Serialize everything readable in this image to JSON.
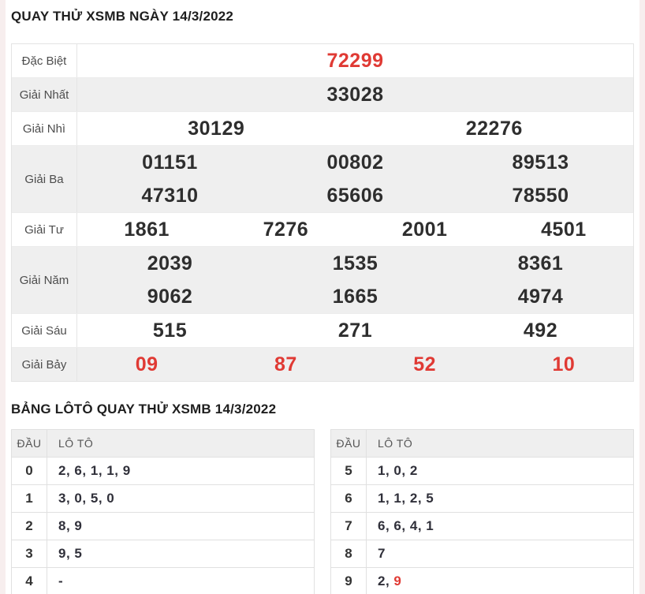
{
  "colors": {
    "accent_red": "#e03a34",
    "stripe_bg": "#efefef",
    "border": "#e4e4e4"
  },
  "page": {
    "title": "QUAY THỬ XSMB NGÀY 14/3/2022",
    "loto_title": "BẢNG LÔTÔ QUAY THỬ XSMB 14/3/2022"
  },
  "results": {
    "rows": [
      {
        "label": "Đặc Biệt",
        "highlight": true,
        "lines": [
          [
            "72299"
          ]
        ]
      },
      {
        "label": "Giải Nhất",
        "highlight": false,
        "lines": [
          [
            "33028"
          ]
        ]
      },
      {
        "label": "Giải Nhì",
        "highlight": false,
        "lines": [
          [
            "30129",
            "22276"
          ]
        ]
      },
      {
        "label": "Giải Ba",
        "highlight": false,
        "lines": [
          [
            "01151",
            "00802",
            "89513"
          ],
          [
            "47310",
            "65606",
            "78550"
          ]
        ]
      },
      {
        "label": "Giải Tư",
        "highlight": false,
        "lines": [
          [
            "1861",
            "7276",
            "2001",
            "4501"
          ]
        ]
      },
      {
        "label": "Giải Năm",
        "highlight": false,
        "lines": [
          [
            "2039",
            "1535",
            "8361"
          ],
          [
            "9062",
            "1665",
            "4974"
          ]
        ]
      },
      {
        "label": "Giải Sáu",
        "highlight": false,
        "lines": [
          [
            "515",
            "271",
            "492"
          ]
        ]
      },
      {
        "label": "Giải Bảy",
        "highlight": true,
        "lines": [
          [
            "09",
            "87",
            "52",
            "10"
          ]
        ]
      }
    ]
  },
  "loto": {
    "headers": {
      "head": "ĐẦU",
      "loto": "LÔ TÔ"
    },
    "left": [
      {
        "head": "0",
        "digits": [
          {
            "d": "2"
          },
          {
            "d": "6"
          },
          {
            "d": "1"
          },
          {
            "d": "1"
          },
          {
            "d": "9"
          }
        ]
      },
      {
        "head": "1",
        "digits": [
          {
            "d": "3"
          },
          {
            "d": "0"
          },
          {
            "d": "5"
          },
          {
            "d": "0"
          }
        ]
      },
      {
        "head": "2",
        "digits": [
          {
            "d": "8"
          },
          {
            "d": "9"
          }
        ]
      },
      {
        "head": "3",
        "digits": [
          {
            "d": "9"
          },
          {
            "d": "5"
          }
        ]
      },
      {
        "head": "4",
        "digits": [
          {
            "d": "-"
          }
        ]
      }
    ],
    "right": [
      {
        "head": "5",
        "digits": [
          {
            "d": "1"
          },
          {
            "d": "0"
          },
          {
            "d": "2"
          }
        ]
      },
      {
        "head": "6",
        "digits": [
          {
            "d": "1"
          },
          {
            "d": "1"
          },
          {
            "d": "2"
          },
          {
            "d": "5"
          }
        ]
      },
      {
        "head": "7",
        "digits": [
          {
            "d": "6"
          },
          {
            "d": "6"
          },
          {
            "d": "4"
          },
          {
            "d": "1"
          }
        ]
      },
      {
        "head": "8",
        "digits": [
          {
            "d": "7"
          }
        ]
      },
      {
        "head": "9",
        "digits": [
          {
            "d": "2"
          },
          {
            "d": "9",
            "red": true
          }
        ]
      }
    ]
  }
}
